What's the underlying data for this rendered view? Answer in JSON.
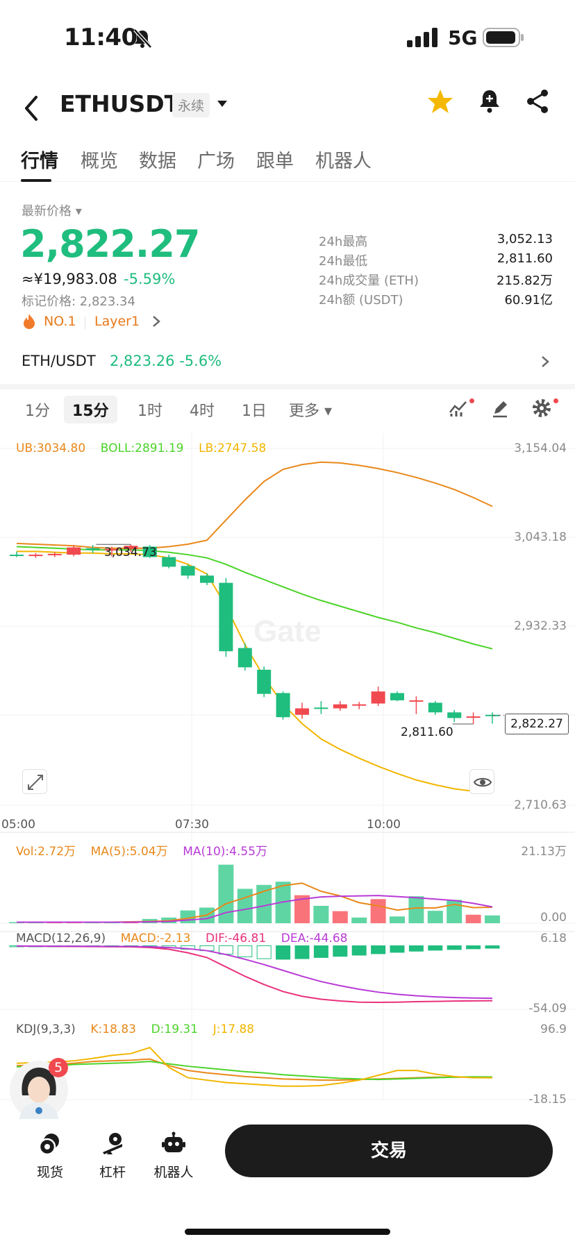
{
  "status": {
    "time": "11:40",
    "network": "5G"
  },
  "header": {
    "title": "ETHUSDT",
    "badge": "永续"
  },
  "tabs": [
    "行情",
    "概览",
    "数据",
    "广场",
    "跟单",
    "机器人"
  ],
  "ticker": {
    "latest_label": "最新价格",
    "price": "2,822.27",
    "cny": "≈¥19,983.08",
    "change": "-5.59%",
    "mark_price": "标记价格: 2,823.34",
    "rank": "NO.1",
    "category": "Layer1",
    "stats": [
      {
        "label": "24h最高",
        "value": "3,052.13"
      },
      {
        "label": "24h最低",
        "value": "2,811.60"
      },
      {
        "label": "24h成交量 (ETH)",
        "value": "215.82万"
      },
      {
        "label": "24h额 (USDT)",
        "value": "60.91亿"
      }
    ]
  },
  "spot_pair": {
    "name": "ETH/USDT",
    "price": "2,823.26",
    "change": "-5.6%"
  },
  "intervals": [
    "1分",
    "15分",
    "1时",
    "4时",
    "1日",
    "更多"
  ],
  "colors": {
    "up": "#f0494f",
    "down": "#1fbd7e",
    "ub": "#e8881a",
    "boll": "#4cd32a",
    "lb": "#f2b500",
    "ma10": "#b83ad6"
  },
  "chart_data": [
    {
      "type": "candlestick",
      "legend": {
        "ub": "UB:3034.80",
        "boll": "BOLL:2891.19",
        "lb": "LB:2747.58"
      },
      "y_ticks": [
        "3,154.04",
        "3,043.18",
        "2,932.33",
        "2,710.63"
      ],
      "ylim": [
        2710.63,
        3154.04
      ],
      "x_ticks": [
        "05:00",
        "07:30",
        "10:00"
      ],
      "annotations": {
        "high": "3,034.73",
        "low": "2,811.60",
        "last": "2,822.27"
      },
      "candles": [
        {
          "o": 3022,
          "h": 3026,
          "l": 3019,
          "c": 3021
        },
        {
          "o": 3021,
          "h": 3024,
          "l": 3018,
          "c": 3022
        },
        {
          "o": 3022,
          "h": 3025,
          "l": 3019,
          "c": 3023
        },
        {
          "o": 3022,
          "h": 3034,
          "l": 3020,
          "c": 3031
        },
        {
          "o": 3030,
          "h": 3034,
          "l": 3024,
          "c": 3028
        },
        {
          "o": 3028,
          "h": 3032,
          "l": 3020,
          "c": 3029
        },
        {
          "o": 3029,
          "h": 3034.73,
          "l": 3025,
          "c": 3033
        },
        {
          "o": 3032,
          "h": 3034,
          "l": 3018,
          "c": 3019
        },
        {
          "o": 3019,
          "h": 3022,
          "l": 3005,
          "c": 3007
        },
        {
          "o": 3008,
          "h": 3010,
          "l": 2992,
          "c": 2996
        },
        {
          "o": 2996,
          "h": 2999,
          "l": 2984,
          "c": 2987
        },
        {
          "o": 2987,
          "h": 2993,
          "l": 2895,
          "c": 2902
        },
        {
          "o": 2906,
          "h": 2912,
          "l": 2878,
          "c": 2882
        },
        {
          "o": 2879,
          "h": 2883,
          "l": 2845,
          "c": 2849
        },
        {
          "o": 2850,
          "h": 2852,
          "l": 2817,
          "c": 2820
        },
        {
          "o": 2823,
          "h": 2838,
          "l": 2818,
          "c": 2831
        },
        {
          "o": 2832,
          "h": 2840,
          "l": 2824,
          "c": 2831
        },
        {
          "o": 2831,
          "h": 2840,
          "l": 2828,
          "c": 2836
        },
        {
          "o": 2835,
          "h": 2839,
          "l": 2830,
          "c": 2836
        },
        {
          "o": 2837,
          "h": 2858,
          "l": 2834,
          "c": 2852
        },
        {
          "o": 2850,
          "h": 2852,
          "l": 2840,
          "c": 2841
        },
        {
          "o": 2841,
          "h": 2846,
          "l": 2824,
          "c": 2841
        },
        {
          "o": 2838,
          "h": 2840,
          "l": 2823,
          "c": 2826
        },
        {
          "o": 2826,
          "h": 2829,
          "l": 2814,
          "c": 2819
        },
        {
          "o": 2820,
          "h": 2826,
          "l": 2811.6,
          "c": 2821
        },
        {
          "o": 2823,
          "h": 2826,
          "l": 2812,
          "c": 2822
        }
      ],
      "ub": [
        3036,
        3035,
        3034,
        3033,
        3031,
        3030,
        3030,
        3030,
        3032,
        3035,
        3040,
        3065,
        3090,
        3113,
        3128,
        3134,
        3137,
        3136,
        3133,
        3129,
        3124,
        3118,
        3111,
        3103,
        3093,
        3082
      ],
      "boll": [
        3032,
        3031,
        3030,
        3029,
        3028,
        3028,
        3028,
        3027,
        3025,
        3022,
        3018,
        3010,
        3000,
        2991,
        2982,
        2973,
        2965,
        2958,
        2951,
        2944,
        2938,
        2931,
        2925,
        2918,
        2911,
        2905
      ],
      "lb": [
        3026,
        3026,
        3025,
        3024,
        3024,
        3023,
        3023,
        3022,
        3018,
        3010,
        2998,
        2958,
        2910,
        2870,
        2836,
        2812,
        2793,
        2780,
        2769,
        2759,
        2750,
        2742,
        2736,
        2731,
        2728,
        2726
      ]
    },
    {
      "type": "bar",
      "legend": {
        "vol": "Vol:2.72万",
        "ma5": "MA(5):5.04万",
        "ma10": "MA(10):4.55万"
      },
      "y_ticks": [
        "21.13万",
        "0.00"
      ],
      "ylim": [
        0,
        21.13
      ],
      "values": [
        0.3,
        0.2,
        0.2,
        0.3,
        0.4,
        0.3,
        0.5,
        1.2,
        1.6,
        3.6,
        4.4,
        16.5,
        9.7,
        10.8,
        11.7,
        7.9,
        4.9,
        3.4,
        1.6,
        6.8,
        1.9,
        7.6,
        3.5,
        6.6,
        2.4,
        2.2
      ],
      "up": [
        false,
        false,
        true,
        true,
        false,
        false,
        true,
        false,
        false,
        false,
        false,
        false,
        false,
        false,
        false,
        true,
        false,
        true,
        false,
        true,
        false,
        false,
        false,
        false,
        true,
        false
      ],
      "ma5": [
        0.3,
        0.3,
        0.3,
        0.3,
        0.3,
        0.3,
        0.4,
        0.5,
        0.7,
        1.4,
        2.3,
        5.5,
        7.2,
        9.0,
        10.6,
        11.3,
        9.0,
        7.7,
        5.8,
        4.9,
        3.7,
        4.3,
        4.3,
        5.3,
        4.4,
        4.5
      ],
      "ma10": [
        0.3,
        0.3,
        0.3,
        0.3,
        0.3,
        0.3,
        0.3,
        0.4,
        0.5,
        0.9,
        1.3,
        3.0,
        3.9,
        4.9,
        6.0,
        6.8,
        7.4,
        7.6,
        7.7,
        7.8,
        7.5,
        7.2,
        6.8,
        6.4,
        5.6,
        4.6
      ]
    },
    {
      "type": "macd",
      "legend": {
        "title": "MACD(12,26,9)",
        "macd": "MACD:-2.13",
        "dif": "DIF:-46.81",
        "dea": "DEA:-44.68"
      },
      "y_ticks": [
        "6.18",
        "-54.09"
      ],
      "ylim": [
        -54.09,
        6.18
      ],
      "hist": [
        -0.5,
        -0.5,
        -0.6,
        -0.6,
        -0.6,
        -0.7,
        -0.7,
        -1.2,
        -1.8,
        -3.0,
        -4.2,
        -7.2,
        -9.4,
        -11.0,
        -11.5,
        -11.0,
        -10.0,
        -9.0,
        -8.0,
        -6.8,
        -5.6,
        -4.6,
        -3.8,
        -3.2,
        -2.6,
        -2.1
      ],
      "dif": [
        -0.3,
        -0.4,
        -0.5,
        -0.6,
        -0.7,
        -0.8,
        -0.9,
        -1.5,
        -3.0,
        -6.0,
        -10.0,
        -18.0,
        -26.0,
        -33.0,
        -39.0,
        -43.0,
        -45.5,
        -47.0,
        -48.0,
        -48.2,
        -48.0,
        -47.6,
        -47.4,
        -47.1,
        -46.9,
        -46.8
      ],
      "dea": [
        -0.2,
        -0.3,
        -0.4,
        -0.4,
        -0.5,
        -0.6,
        -0.6,
        -0.8,
        -1.5,
        -2.5,
        -4.2,
        -7.5,
        -11.5,
        -16.0,
        -21.0,
        -26.0,
        -30.5,
        -34.0,
        -37.0,
        -39.5,
        -41.3,
        -42.6,
        -43.5,
        -44.1,
        -44.5,
        -44.7
      ]
    },
    {
      "type": "kdj",
      "legend": {
        "title": "KDJ(9,3,3)",
        "k": "K:18.83",
        "d": "D:19.31",
        "j": "J:17.88"
      },
      "y_ticks": [
        "96.9",
        "-18.15"
      ],
      "ylim": [
        -18.15,
        96.9
      ],
      "k": [
        38,
        39,
        40,
        42,
        45,
        46,
        47,
        49,
        38,
        30,
        26,
        23,
        20,
        18,
        16,
        15,
        14,
        14,
        15,
        16,
        17,
        18,
        19,
        19,
        19,
        18.83
      ],
      "d": [
        36,
        37,
        38,
        40,
        41,
        42,
        43,
        45,
        41,
        37,
        34,
        31,
        28,
        26,
        23,
        21,
        19,
        17,
        16,
        15,
        16,
        17,
        18,
        19,
        19.5,
        19.31
      ],
      "j": [
        42,
        43,
        44,
        46,
        50,
        55,
        58,
        68,
        35,
        18,
        14,
        10,
        8,
        6,
        4,
        4,
        5,
        9,
        14,
        22,
        30,
        30,
        24,
        20,
        18,
        17.88
      ]
    }
  ],
  "bottom_nav": [
    "现货",
    "杠杆",
    "机器人"
  ],
  "trade_label": "交易",
  "assistant_badge": "5"
}
